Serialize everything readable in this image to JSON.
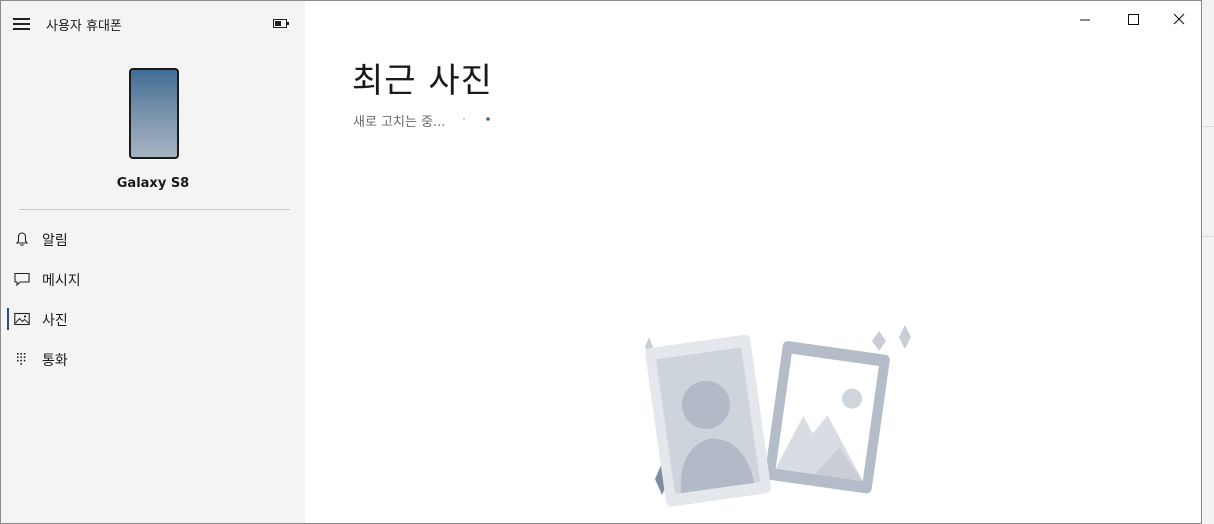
{
  "app": {
    "title": "사용자 휴대폰"
  },
  "device": {
    "name": "Galaxy S8",
    "battery_level": 0.55
  },
  "nav": {
    "items": [
      {
        "label": "알림",
        "icon": "bell-icon",
        "active": false
      },
      {
        "label": "메시지",
        "icon": "chat-icon",
        "active": false
      },
      {
        "label": "사진",
        "icon": "photo-icon",
        "active": true
      },
      {
        "label": "통화",
        "icon": "dialpad-icon",
        "active": false
      }
    ]
  },
  "main": {
    "title": "최근 사진",
    "status": "새로 고치는 중..."
  },
  "colors": {
    "accent": "#26508a",
    "sidebar_bg": "#f4f4f4",
    "illustration_gray": "#c9ced6"
  }
}
